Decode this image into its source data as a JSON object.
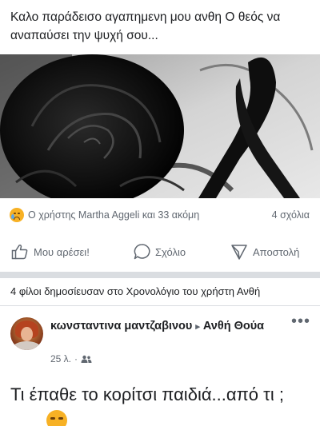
{
  "post": {
    "text": "Καλο παράδεισο αγαπημενη μου ανθη  Ο θεός να αναπαύσει την ψυχή σου..."
  },
  "reactions": {
    "emoji_icon": "sad-face-icon",
    "reactors": "Ο χρήστης Martha Aggeli και 33 ακόμη",
    "comments": "4 σχόλια"
  },
  "actions": {
    "like": "Μου αρέσει!",
    "comment": "Σχόλιο",
    "share": "Αποστολή"
  },
  "shared_note": "4 φίλοι δημοσίευσαν στο Χρονολόγιο του χρήστη Ανθή",
  "second_post": {
    "author": "κωνσταντινα μαντζαβινου",
    "arrow": "▸",
    "target": "Ανθή Θούα",
    "time": "25 λ.",
    "dot": "·",
    "audience_icon": "friends-icon",
    "more": "•••",
    "text": "Τι έπαθε το κορίτσι παιδιά...από τι ;"
  },
  "colors": {
    "text": "#1c1e21",
    "secondary": "#606770",
    "divider": "#dadde1",
    "reaction_yellow": "#f7b125"
  }
}
